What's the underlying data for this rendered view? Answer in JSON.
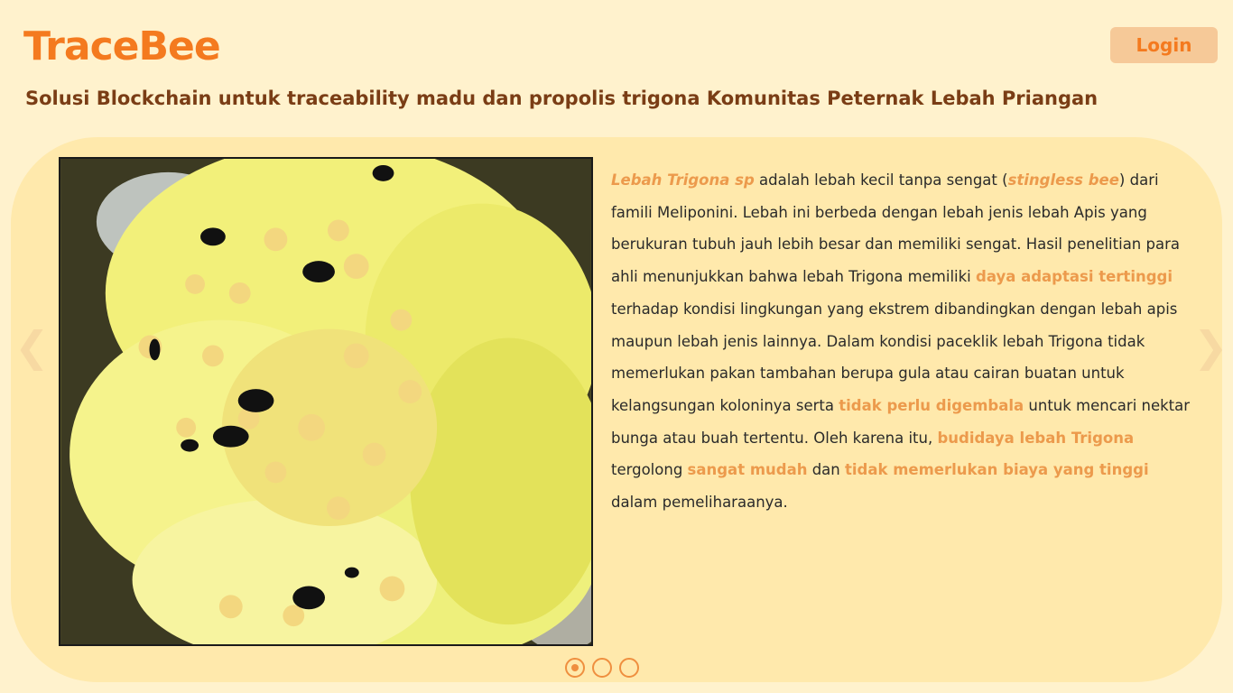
{
  "header": {
    "logo": "TraceBee",
    "login_label": "Login"
  },
  "subtitle": "Solusi Blockchain untuk traceability madu dan propolis trigona Komunitas Peternak Lebah Priangan",
  "carousel": {
    "prev_icon": "chevron-left-icon",
    "next_icon": "chevron-right-icon",
    "slides": 3,
    "active_slide": 1,
    "image_alt": "Lebah trigona pada bunga kuning",
    "article": {
      "t1": "Lebah Trigona sp",
      "t2": " adalah lebah kecil tanpa sengat (",
      "t3": "stingless bee",
      "t4": ") dari famili Meliponini. Lebah ini berbeda dengan lebah jenis lebah Apis yang berukuran tubuh jauh lebih besar dan memiliki sengat. Hasil penelitian para ahli menunjukkan bahwa lebah Trigona memiliki ",
      "t5": "daya adaptasi tertinggi",
      "t6": " terhadap kondisi lingkungan yang ekstrem dibandingkan dengan lebah apis maupun lebah jenis lainnya. Dalam kondisi paceklik lebah Trigona tidak memerlukan pakan tambahan berupa gula atau cairan buatan untuk kelangsungan koloninya serta ",
      "t7": "tidak perlu digembala",
      "t8": " untuk mencari nektar bunga atau buah tertentu. Oleh karena itu, ",
      "t9": "budidaya lebah Trigona",
      "t10": " tergolong ",
      "t11": "sangat mudah",
      "t12": " dan ",
      "t13": "tidak memerlukan biaya yang tinggi",
      "t14": " dalam pemeliharaanya."
    }
  },
  "colors": {
    "background": "#fff2cd",
    "card": "#ffe9ac",
    "brand": "#f47a1f",
    "highlight": "#ec9a4c",
    "subtitle": "#7a3d15"
  }
}
